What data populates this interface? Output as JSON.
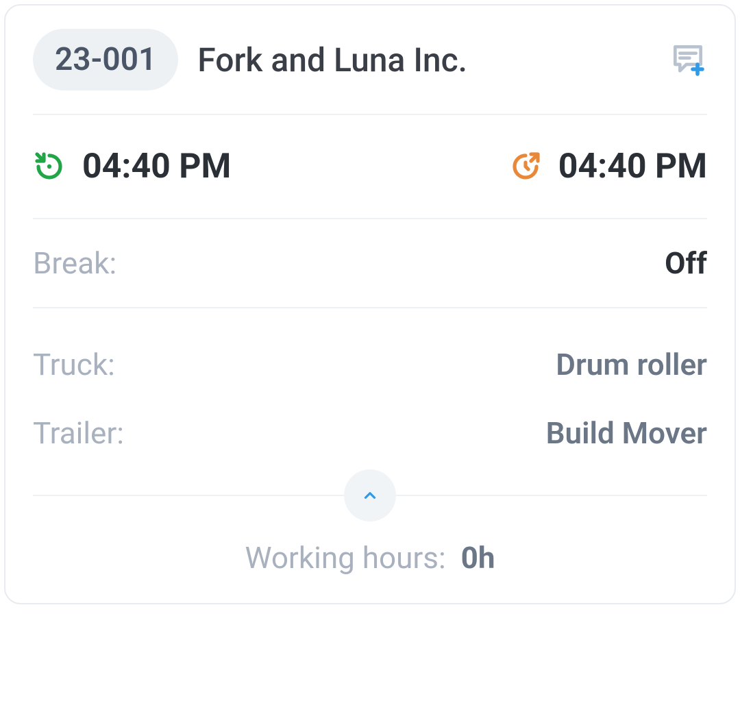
{
  "header": {
    "badge": "23-001",
    "company": "Fork and Luna Inc."
  },
  "times": {
    "start": "04:40 PM",
    "end": "04:40 PM"
  },
  "break": {
    "label": "Break:",
    "value": "Off"
  },
  "truck": {
    "label": "Truck:",
    "value": "Drum roller"
  },
  "trailer": {
    "label": "Trailer:",
    "value": "Build Mover"
  },
  "footer": {
    "label": "Working hours:",
    "value": "0h"
  },
  "colors": {
    "start_icon": "#22a547",
    "end_icon": "#e8893a",
    "note_icon_base": "#b8c3cf",
    "note_icon_plus": "#2f9be8",
    "chevron": "#2f9be8"
  }
}
